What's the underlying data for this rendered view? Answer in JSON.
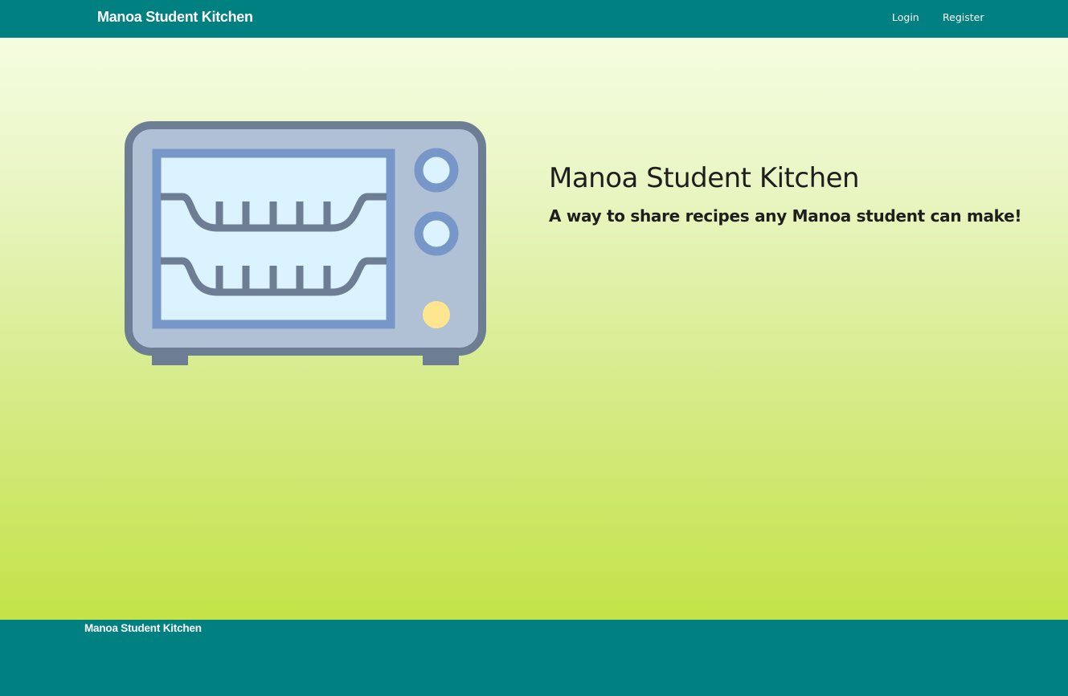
{
  "navbar": {
    "brand": "Manoa Student Kitchen",
    "links": [
      {
        "label": "Login"
      },
      {
        "label": "Register"
      }
    ]
  },
  "hero": {
    "image_icon": "toaster-oven-icon",
    "title": "Manoa Student Kitchen",
    "subtitle": "A way to share recipes any Manoa student can make!"
  },
  "footer": {
    "text": "Manoa Student Kitchen"
  },
  "colors": {
    "navbar": "#008080",
    "footer": "#008080",
    "gradient_top": "#f5fde0",
    "gradient_bottom": "#c3e347",
    "oven_body": "#b0c1d6",
    "oven_outline": "#6d7d94",
    "oven_window": "#dbf2ff",
    "oven_window_frame": "#7797c8",
    "oven_light": "#fde68f"
  }
}
